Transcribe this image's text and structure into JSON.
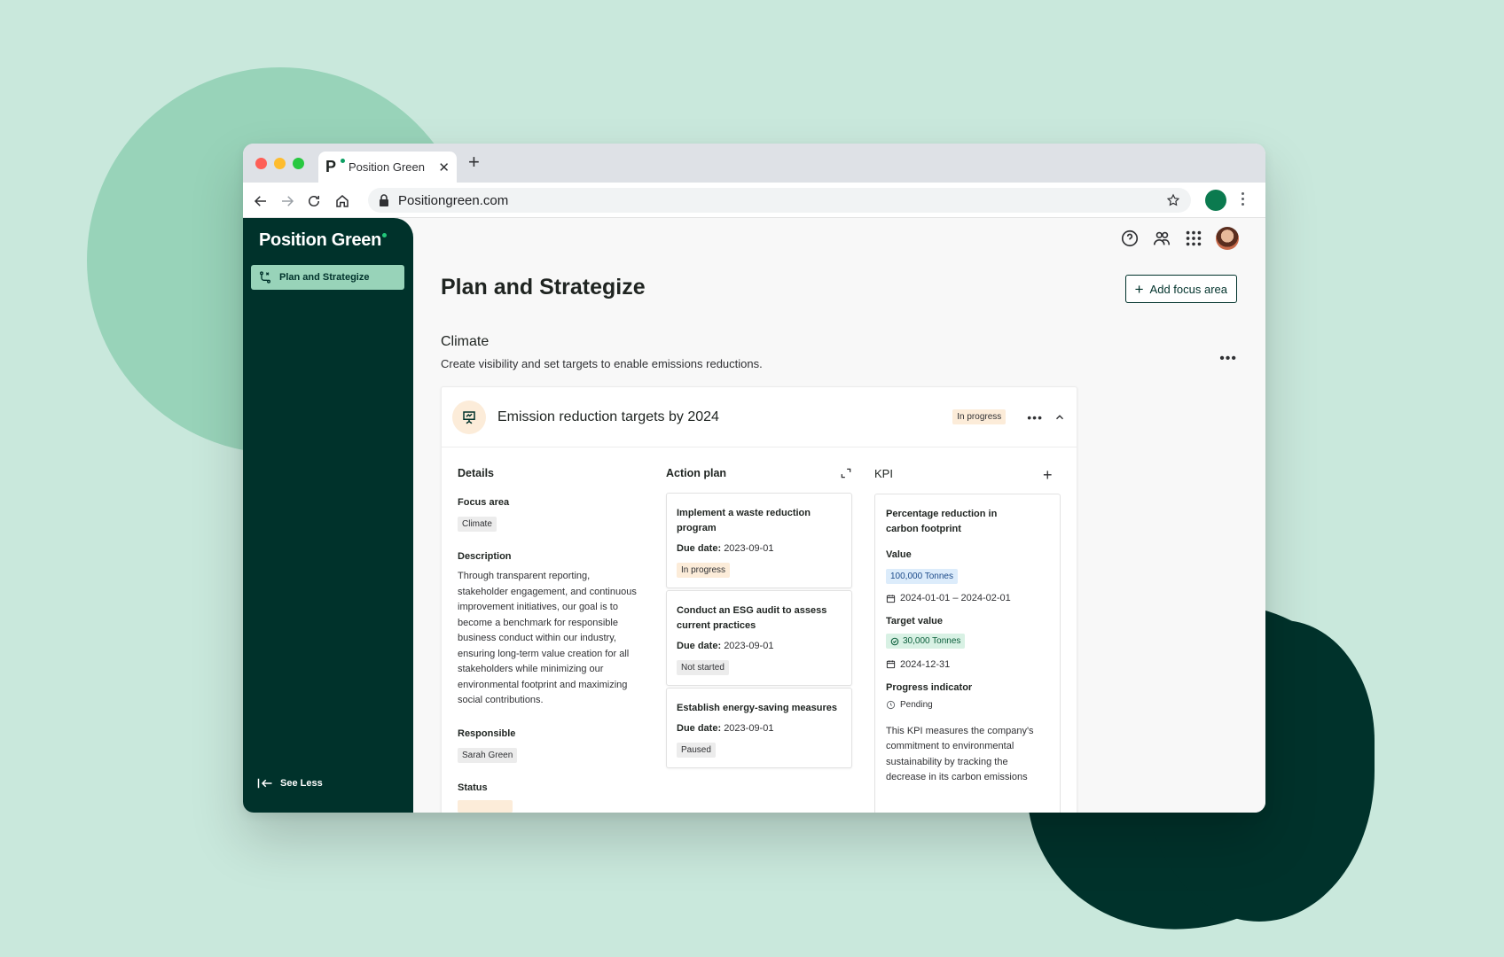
{
  "browser": {
    "tab_title": "Position Green",
    "tab_logo": "P",
    "url": "Positiongreen.com"
  },
  "sidebar": {
    "brand": "Position Green",
    "items": [
      {
        "label": "Plan and Strategize",
        "icon": "strategy-icon",
        "active": true
      }
    ],
    "see_less": "See Less"
  },
  "header": {
    "icons": [
      "help-icon",
      "users-icon",
      "apps-grid-icon",
      "avatar"
    ]
  },
  "page": {
    "title": "Plan and Strategize",
    "add_button": "Add focus area"
  },
  "section": {
    "title": "Climate",
    "description": "Create visibility and set targets to enable emissions reductions."
  },
  "card": {
    "title": "Emission reduction targets by 2024",
    "status": "In progress",
    "details": {
      "title": "Details",
      "focus_area_label": "Focus area",
      "focus_area": "Climate",
      "description_label": "Description",
      "description": "Through transparent reporting, stakeholder engagement, and continuous improvement initiatives, our goal is to become a benchmark for responsible business conduct within our industry, ensuring long-term value creation for all stakeholders while minimizing our environmental footprint and maximizing social contributions.",
      "responsible_label": "Responsible",
      "responsible": "Sarah Green",
      "status_label": "Status"
    },
    "action_plan": {
      "title": "Action plan",
      "due_label": "Due date:",
      "items": [
        {
          "name": "Implement a waste reduction program",
          "due": "2023-09-01",
          "status": "In progress"
        },
        {
          "name": "Conduct an ESG audit to assess current practices",
          "due": "2023-09-01",
          "status": "Not started"
        },
        {
          "name": "Establish energy-saving measures",
          "due": "2023-09-01",
          "status": "Paused"
        }
      ]
    },
    "kpi": {
      "title": "KPI",
      "name": "Percentage reduction in carbon footprint",
      "value_label": "Value",
      "value": "100,000 Tonnes",
      "value_period": "2024-01-01 – 2024-02-01",
      "target_label": "Target value",
      "target": "30,000 Tonnes",
      "target_date": "2024-12-31",
      "progress_label": "Progress indicator",
      "progress": "Pending",
      "text": "This KPI measures the company's commitment to environmental sustainability by tracking the decrease in its carbon emissions"
    }
  },
  "colors": {
    "sidebar": "#00322b",
    "accent": "#98d3b9",
    "background": "#c9e8dc"
  }
}
